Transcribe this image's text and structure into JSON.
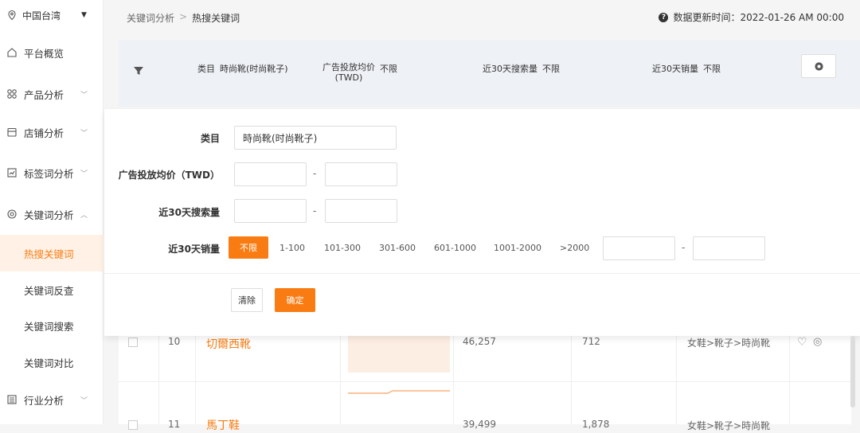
{
  "sidebar": {
    "region": "中国台湾",
    "items": [
      {
        "label": "平台概览"
      },
      {
        "label": "产品分析"
      },
      {
        "label": "店铺分析"
      },
      {
        "label": "标签词分析"
      },
      {
        "label": "关键词分析"
      }
    ],
    "sub_items": [
      {
        "label": "热搜关键词"
      },
      {
        "label": "关键词反查"
      },
      {
        "label": "关键词搜索"
      },
      {
        "label": "关键词对比"
      }
    ],
    "industry": "行业分析"
  },
  "header": {
    "breadcrumb_parent": "关键词分析",
    "breadcrumb_sep": ">",
    "breadcrumb_current": "热搜关键词",
    "update_text": "数据更新时间：2022-01-26 AM 00:00"
  },
  "summary": {
    "category_label": "类目",
    "category_value": "時尚靴(时尚靴子)",
    "ad_label_line1": "广告投放均价",
    "ad_label_line2": "(TWD)",
    "ad_value": "不限",
    "search_label": "近30天搜索量",
    "search_value": "不限",
    "sales_label": "近30天销量",
    "sales_value": "不限"
  },
  "filter": {
    "category_label": "类目",
    "category_value": "時尚靴(时尚靴子)",
    "ad_label": "广告投放均价（TWD）",
    "search_label": "近30天搜索量",
    "sales_label": "近30天销量",
    "dash": "-",
    "sales_options": [
      "不限",
      "1-100",
      "101-300",
      "301-600",
      "601-1000",
      "1001-2000",
      ">2000"
    ],
    "clear_label": "清除",
    "ok_label": "确定"
  },
  "table": {
    "rows": [
      {
        "rank": "10",
        "keyword": "切爾西靴",
        "search": "46,257",
        "sales": "712",
        "category": "女鞋>靴子>時尚靴"
      },
      {
        "rank": "11",
        "keyword": "馬丁鞋",
        "search": "39,499",
        "sales": "1,878",
        "category": "女鞋>靴子>時尚靴"
      }
    ]
  },
  "colors": {
    "accent": "#f97c12",
    "active_bg": "#fff1e6"
  }
}
